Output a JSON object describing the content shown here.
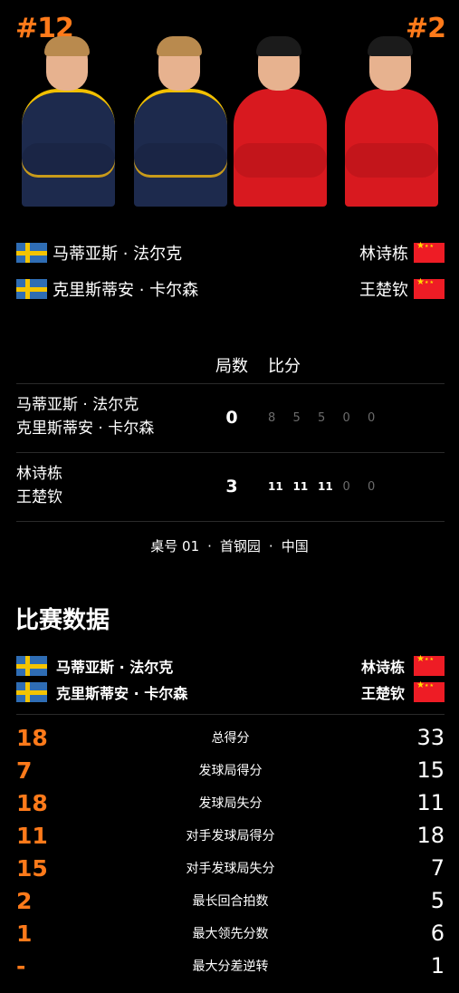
{
  "header": {
    "left_rank": "#12",
    "right_rank": "#2"
  },
  "teams": {
    "left": {
      "flag": "sweden-flag",
      "players": [
        "马蒂亚斯 · 法尔克",
        "克里斯蒂安 · 卡尔森"
      ]
    },
    "right": {
      "flag": "china-flag",
      "players": [
        "林诗栋",
        "王楚钦"
      ]
    }
  },
  "scoreboard": {
    "games_label": "局数",
    "points_label": "比分",
    "left": {
      "players": [
        "马蒂亚斯 · 法尔克",
        "克里斯蒂安 · 卡尔森"
      ],
      "games": "0",
      "sets": [
        "8",
        "5",
        "5",
        "0",
        "0"
      ]
    },
    "right": {
      "players": [
        "林诗栋",
        "王楚钦"
      ],
      "games": "3",
      "sets": [
        "11",
        "11",
        "11",
        "0",
        "0"
      ]
    }
  },
  "venue": {
    "table": "桌号 01",
    "arena": "首钢园",
    "country": "中国",
    "separator": "·"
  },
  "stats_section": {
    "title": "比赛数据",
    "left_players": [
      "马蒂亚斯 · 法尔克",
      "克里斯蒂安 · 卡尔森"
    ],
    "right_players": [
      "林诗栋",
      "王楚钦"
    ],
    "rows": [
      {
        "label": "总得分",
        "left": "18",
        "right": "33"
      },
      {
        "label": "发球局得分",
        "left": "7",
        "right": "15"
      },
      {
        "label": "发球局失分",
        "left": "18",
        "right": "11"
      },
      {
        "label": "对手发球局得分",
        "left": "11",
        "right": "18"
      },
      {
        "label": "对手发球局失分",
        "left": "15",
        "right": "7"
      },
      {
        "label": "最长回合拍数",
        "left": "2",
        "right": "5"
      },
      {
        "label": "最大领先分数",
        "left": "1",
        "right": "6"
      },
      {
        "label": "最大分差逆转",
        "left": "-",
        "right": "1"
      }
    ]
  },
  "colors": {
    "accent": "#ff7a1a",
    "background": "#000000",
    "sweden_blue": "#2f6db4",
    "sweden_yellow": "#f4c400",
    "china_red": "#ee1c25"
  }
}
